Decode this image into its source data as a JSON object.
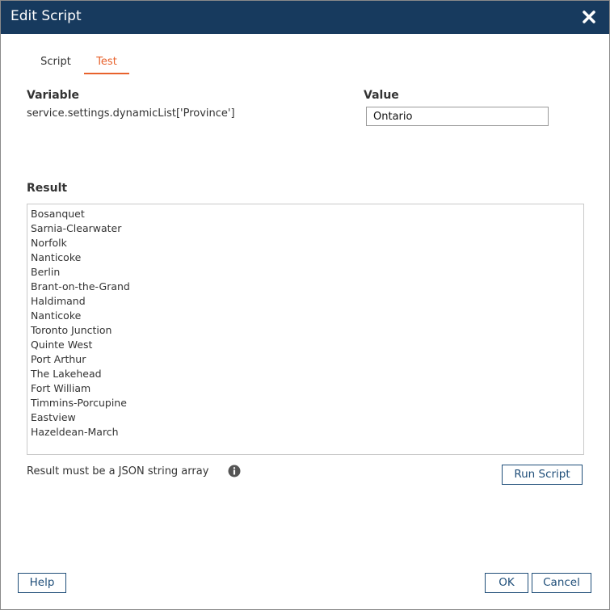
{
  "dialog": {
    "title": "Edit Script",
    "close_icon": "close-icon"
  },
  "tabs": [
    {
      "label": "Script",
      "active": false
    },
    {
      "label": "Test",
      "active": true
    }
  ],
  "variable": {
    "label": "Variable",
    "value": "service.settings.dynamicList['Province']"
  },
  "value_field": {
    "label": "Value",
    "value": "Ontario"
  },
  "result": {
    "label": "Result",
    "items": [
      "Bosanquet",
      "Sarnia-Clearwater",
      "Norfolk",
      "Nanticoke",
      "Berlin",
      "Brant-on-the-Grand",
      "Haldimand",
      "Nanticoke",
      "Toronto Junction",
      "Quinte West",
      "Port Arthur",
      "The Lakehead",
      "Fort William",
      "Timmins-Porcupine",
      "Eastview",
      "Hazeldean-March"
    ],
    "note": "Result must be a JSON string array",
    "note_icon": "info-icon"
  },
  "buttons": {
    "run_script": "Run Script",
    "help": "Help",
    "ok": "OK",
    "cancel": "Cancel"
  },
  "colors": {
    "titlebar": "#173a5e",
    "active_tab": "#e8622c",
    "button_border": "#1f4e79"
  }
}
